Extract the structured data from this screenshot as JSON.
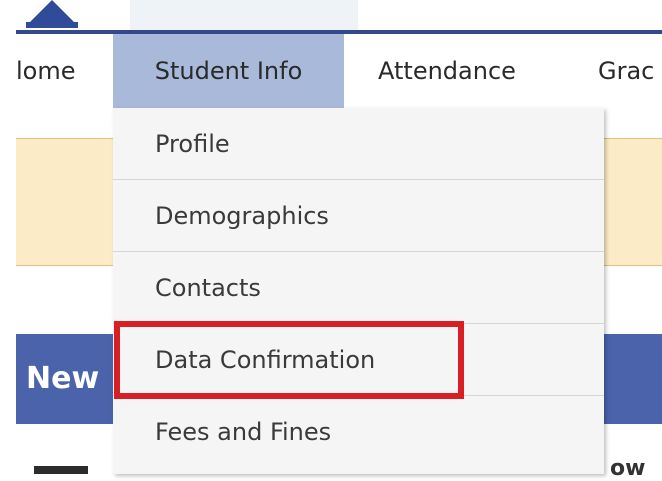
{
  "nav": {
    "items": [
      {
        "label": "lome"
      },
      {
        "label": "Student Info"
      },
      {
        "label": "Attendance"
      },
      {
        "label": "Grac"
      }
    ]
  },
  "dropdown": {
    "items": [
      {
        "label": "Profile"
      },
      {
        "label": "Demographics"
      },
      {
        "label": "Contacts"
      },
      {
        "label": "Data Confirmation"
      },
      {
        "label": "Fees and Fines"
      }
    ]
  },
  "content": {
    "news_title": "New",
    "bottom_fragment": "ow"
  },
  "colors": {
    "header_rule": "#324a8c",
    "active_tab": "#a9b9d9",
    "alert_band": "#fbecc7",
    "news_bar": "#4a63ab",
    "highlight": "#d81f26"
  }
}
